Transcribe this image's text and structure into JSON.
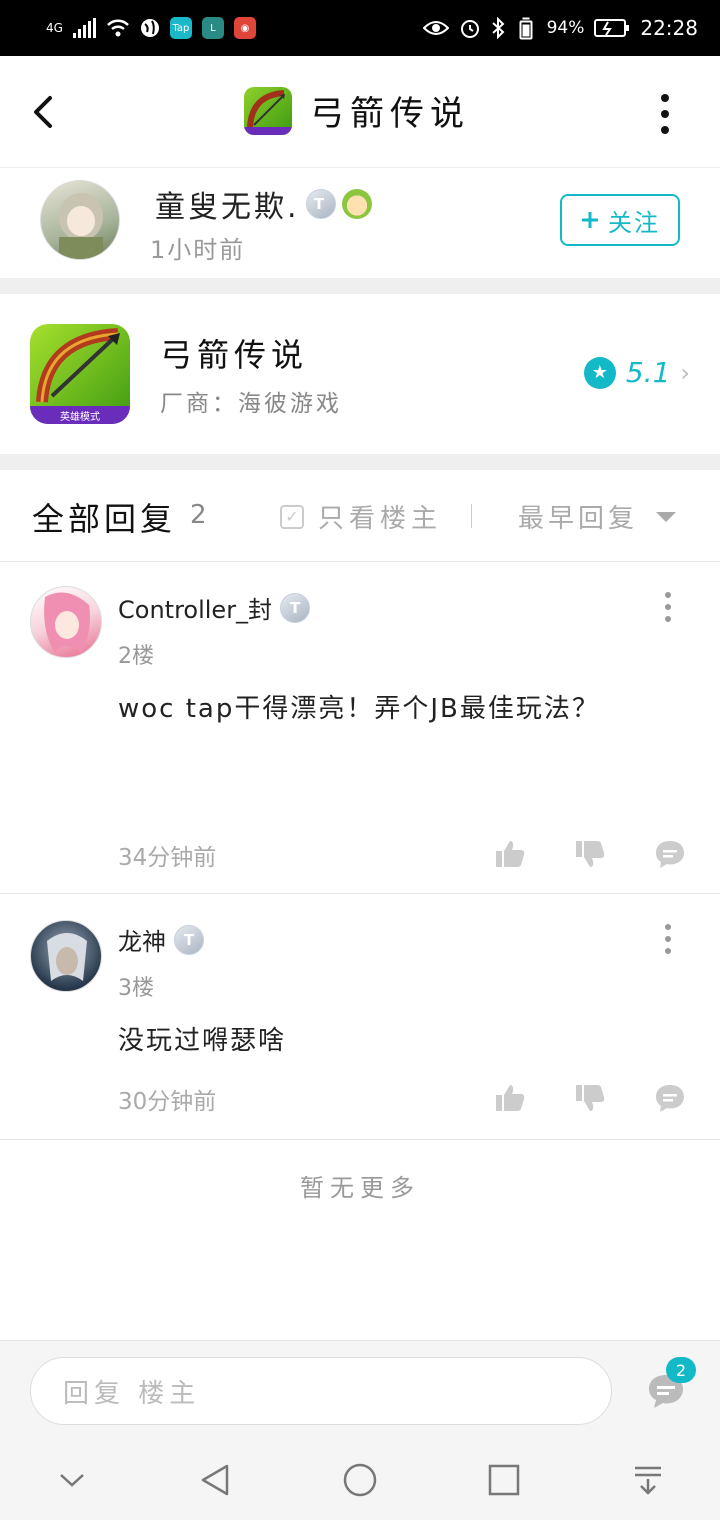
{
  "status_bar": {
    "network": "4G",
    "battery": "94%",
    "time": "22:28",
    "apps": [
      {
        "label": "Tap",
        "color": "#1bb8c9"
      },
      {
        "label": "L",
        "color": "#2a8a86"
      },
      {
        "label": "◉",
        "color": "#e0453a"
      }
    ]
  },
  "header": {
    "title": "弓箭传说",
    "back_icon": "chevron-left-icon",
    "more_icon": "more-vertical-icon"
  },
  "author": {
    "name": "童叟无欺.",
    "badge": "T",
    "badge_level": "1",
    "time": "1小时前",
    "follow_label": "关注",
    "follow_icon": "plus-icon"
  },
  "game": {
    "name": "弓箭传说",
    "developer": "厂商：海彼游戏",
    "icon_tag": "英雄模式",
    "rating": "5.1"
  },
  "replies": {
    "title": "全部回复",
    "count": "2",
    "only_op_label": "只看楼主",
    "sort_label": "最早回复"
  },
  "comments": [
    {
      "user": "Controller_封",
      "badge": "T",
      "level": "1",
      "floor": "2楼",
      "text": "woc tap干得漂亮！弄个JB最佳玩法？",
      "time": "34分钟前"
    },
    {
      "user": "龙神",
      "badge": "T",
      "level": "3",
      "floor": "3楼",
      "text": "没玩过嘚瑟啥",
      "time": "30分钟前"
    }
  ],
  "no_more": "暂无更多",
  "input": {
    "placeholder": "回复 楼主",
    "comment_count": "2"
  },
  "colors": {
    "accent": "#14b9c8",
    "divider": "#efefef",
    "muted": "#999999"
  }
}
